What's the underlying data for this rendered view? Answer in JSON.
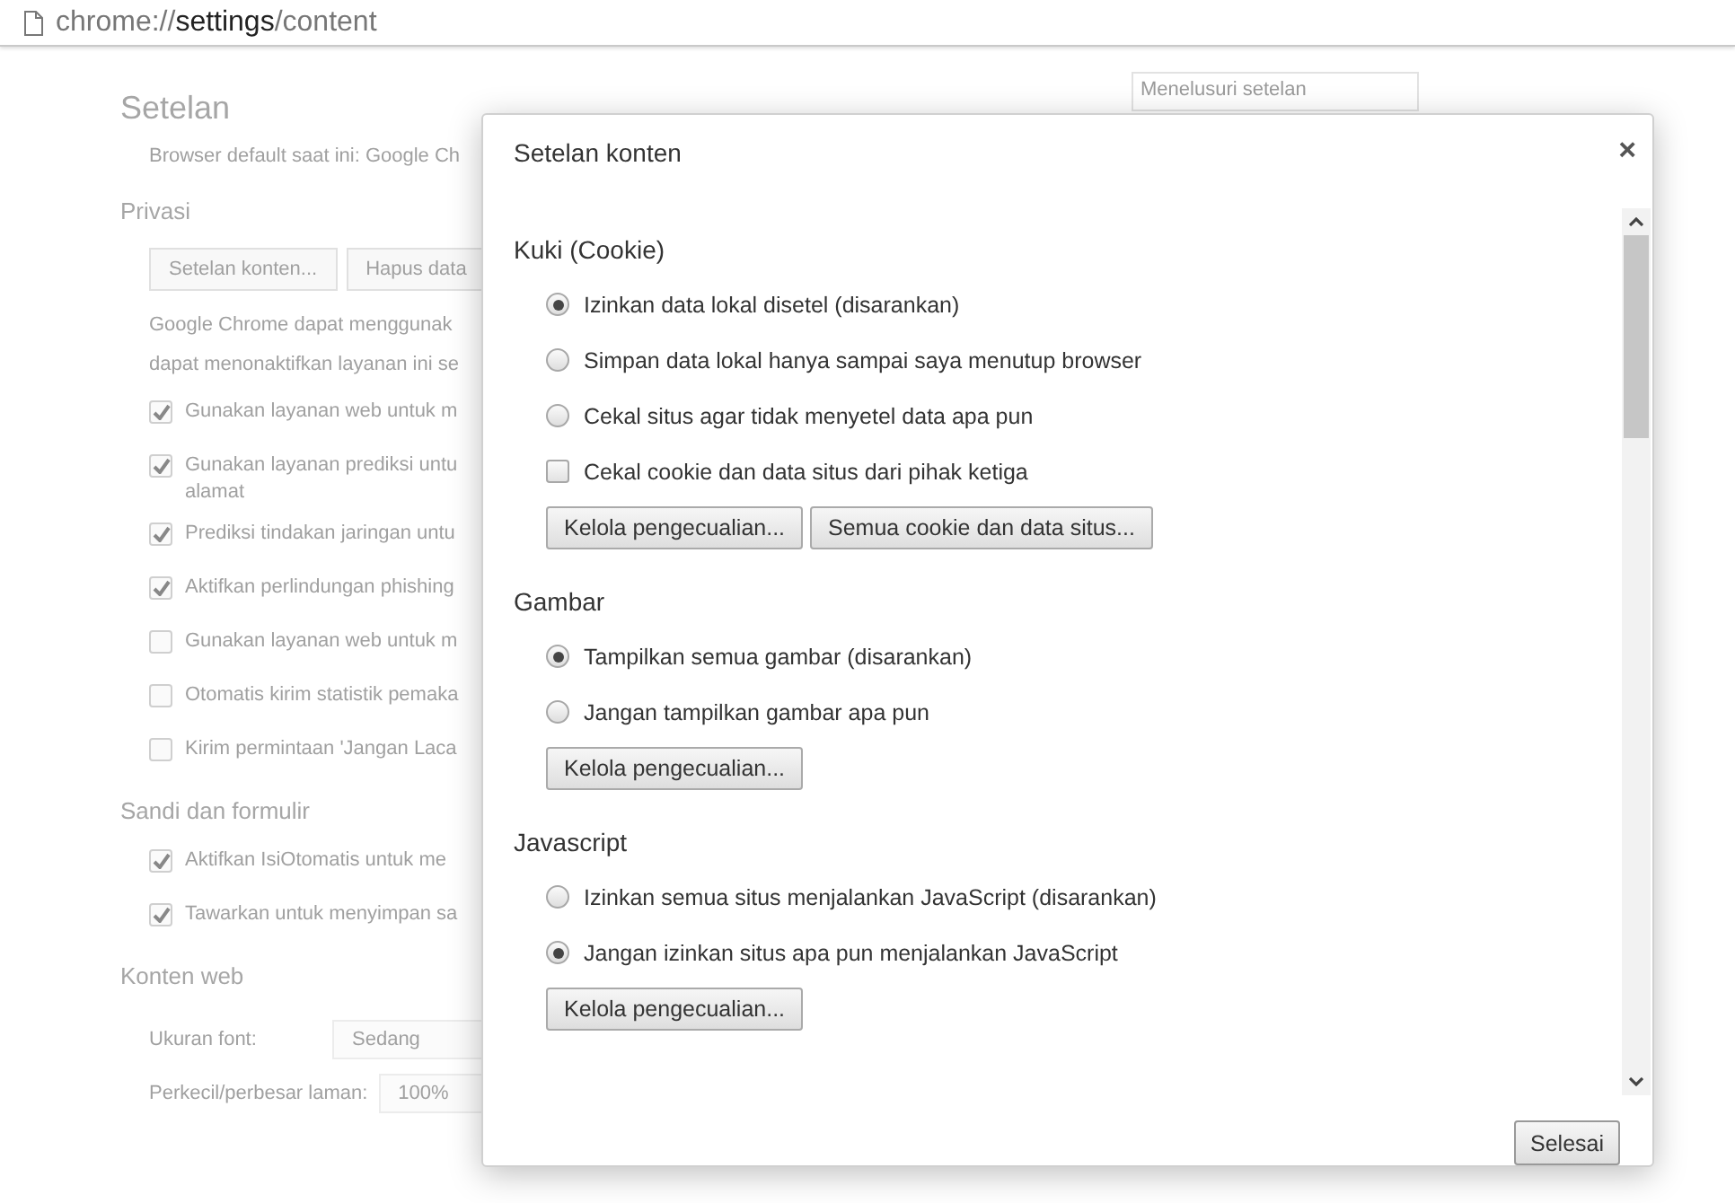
{
  "address_bar": {
    "url_prefix": "chrome://",
    "url_host": "settings",
    "url_suffix": "/content"
  },
  "settings_page": {
    "title": "Setelan",
    "search": {
      "placeholder": "Menelusuri setelan"
    },
    "sections": [
      {
        "items": [
          {
            "kind": "text",
            "text": "Browser default saat ini: Google Ch"
          }
        ]
      },
      {
        "heading": "Privasi",
        "items": [
          {
            "kind": "buttons",
            "buttons": [
              "Setelan konten...",
              "Hapus data"
            ]
          },
          {
            "kind": "text",
            "text": "Google Chrome dapat menggunak"
          },
          {
            "kind": "text",
            "text": "dapat menonaktifkan layanan ini se"
          },
          {
            "kind": "checkbox",
            "label": "Gunakan layanan web untuk m",
            "checked": true
          },
          {
            "kind": "checkbox",
            "label": "Gunakan layanan prediksi untu",
            "label_2": "alamat",
            "checked": true
          },
          {
            "kind": "checkbox",
            "label": "Prediksi tindakan jaringan untu",
            "checked": true
          },
          {
            "kind": "checkbox",
            "label": "Aktifkan perlindungan phishing",
            "checked": true
          },
          {
            "kind": "checkbox",
            "label": "Gunakan layanan web untuk m",
            "checked": false
          },
          {
            "kind": "checkbox",
            "label": "Otomatis kirim statistik pemaka",
            "checked": false
          },
          {
            "kind": "checkbox",
            "label": "Kirim permintaan 'Jangan Laca",
            "checked": false
          }
        ]
      },
      {
        "heading": "Sandi dan formulir",
        "items": [
          {
            "kind": "checkbox",
            "label": "Aktifkan IsiOtomatis untuk me",
            "checked": true
          },
          {
            "kind": "checkbox",
            "label": "Tawarkan untuk menyimpan sa",
            "checked": true
          }
        ]
      },
      {
        "heading": "Konten web",
        "items": [
          {
            "kind": "select",
            "label": "Ukuran font:",
            "value": "Sedang"
          },
          {
            "kind": "select",
            "label": "Perkecil/perbesar laman:",
            "value": "100%"
          }
        ]
      }
    ]
  },
  "dialog": {
    "title": "Setelan konten",
    "close": "×",
    "sections": [
      {
        "heading": "Kuki (Cookie)",
        "options": [
          {
            "kind": "radio",
            "label": "Izinkan data lokal disetel (disarankan)",
            "selected": true
          },
          {
            "kind": "radio",
            "label": "Simpan data lokal hanya sampai saya menutup browser",
            "selected": false
          },
          {
            "kind": "radio",
            "label": "Cekal situs agar tidak menyetel data apa pun",
            "selected": false
          },
          {
            "kind": "checkbox",
            "label": "Cekal cookie dan data situs dari pihak ketiga",
            "checked": false
          }
        ],
        "buttons": [
          "Kelola pengecualian...",
          "Semua cookie dan data situs..."
        ]
      },
      {
        "heading": "Gambar",
        "options": [
          {
            "kind": "radio",
            "label": "Tampilkan semua gambar (disarankan)",
            "selected": true
          },
          {
            "kind": "radio",
            "label": "Jangan tampilkan gambar apa pun",
            "selected": false
          }
        ],
        "buttons": [
          "Kelola pengecualian..."
        ]
      },
      {
        "heading": "Javascript",
        "options": [
          {
            "kind": "radio",
            "label": "Izinkan semua situs menjalankan JavaScript (disarankan)",
            "selected": false
          },
          {
            "kind": "radio",
            "label": "Jangan izinkan situs apa pun menjalankan JavaScript",
            "selected": true
          }
        ],
        "buttons": [
          "Kelola pengecualian..."
        ]
      }
    ],
    "done_button": "Selesai"
  }
}
